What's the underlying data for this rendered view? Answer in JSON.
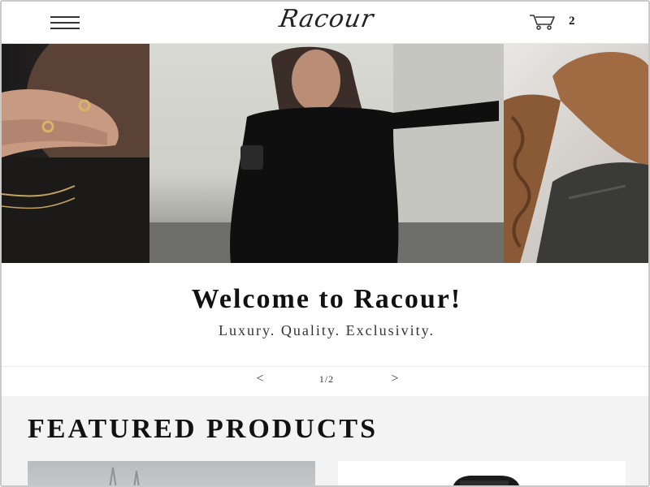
{
  "header": {
    "menu_icon": "hamburger-menu-icon",
    "logo_text": "Racour",
    "cart_icon": "shopping-cart-icon",
    "cart_count": "2"
  },
  "hero": {
    "images": [
      "jewelry-rings-image",
      "black-dress-model-image",
      "braided-hair-leather-jacket-image"
    ],
    "title": "Welcome to Racour!",
    "subtitle": "Luxury. Quality. Exclusivity.",
    "pager": {
      "prev_label": "<",
      "counter": "1/2",
      "next_label": ">"
    }
  },
  "featured": {
    "title": "FEATURED PRODUCTS",
    "products": [
      {
        "image": "product-image-1"
      },
      {
        "image": "product-image-2"
      }
    ]
  },
  "colors": {
    "background": "#ffffff",
    "featured_background": "#f3f3f3",
    "text": "#111111"
  }
}
